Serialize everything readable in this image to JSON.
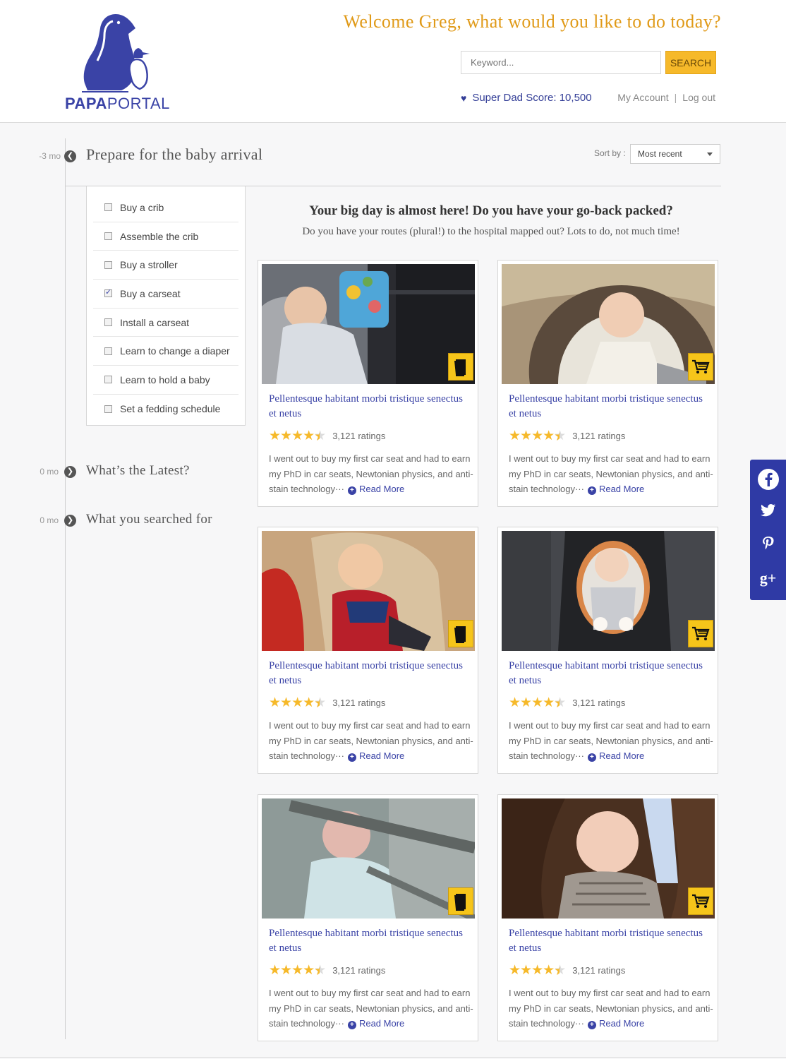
{
  "brand": {
    "name_bold": "PAPA",
    "name_light": "PORTAL"
  },
  "header": {
    "welcome": "Welcome Greg, what would you like to do today?",
    "search_placeholder": "Keyword...",
    "search_button": "SEARCH",
    "score_label": "Super Dad Score: 10,500",
    "my_account": "My Account",
    "separator": "|",
    "logout": "Log out"
  },
  "timeline": [
    {
      "mo": "-3 mo",
      "title": "Prepare for the baby arrival",
      "icon": "arrow-left-circle-icon"
    },
    {
      "mo": "0 mo",
      "title": "What’s the Latest?",
      "icon": "arrow-right-circle-icon"
    },
    {
      "mo": "0 mo",
      "title": "What you searched for",
      "icon": "arrow-right-circle-icon"
    }
  ],
  "sort": {
    "label": "Sort by :",
    "value": "Most recent"
  },
  "checklist": [
    {
      "label": "Buy a crib",
      "checked": false
    },
    {
      "label": "Assemble the crib",
      "checked": false
    },
    {
      "label": "Buy a stroller",
      "checked": false
    },
    {
      "label": "Buy a carseat",
      "checked": true
    },
    {
      "label": "Install a carseat",
      "checked": false
    },
    {
      "label": "Learn to change a diaper",
      "checked": false
    },
    {
      "label": "Learn to hold a baby",
      "checked": false
    },
    {
      "label": "Set a fedding schedule",
      "checked": false
    }
  ],
  "main": {
    "headline": "Your big day is almost here! Do you have your go-back packed?",
    "subhead": "Do you have your routes (plural!) to the hospital mapped out? Lots to do, not much time!"
  },
  "cards": [
    {
      "badge": "document-icon",
      "title": "Pellentesque habitant morbi tristique senectus et netus",
      "rating": 4.5,
      "ratings_text": "3,121 ratings",
      "desc": "I went out to buy my first car seat and had to earn my PhD in car seats, Newtonian physics, and anti-stain technology···",
      "read_more": "Read More"
    },
    {
      "badge": "cart-icon",
      "title": "Pellentesque habitant morbi tristique senectus et netus",
      "rating": 4.5,
      "ratings_text": "3,121 ratings",
      "desc": "I went out to buy my first car seat and had to earn my PhD in car seats, Newtonian physics, and anti-stain technology···",
      "read_more": "Read More"
    },
    {
      "badge": "document-icon",
      "title": "Pellentesque habitant morbi tristique senectus et netus",
      "rating": 4.5,
      "ratings_text": "3,121 ratings",
      "desc": "I went out to buy my first car seat and had to earn my PhD in car seats, Newtonian physics, and anti-stain technology···",
      "read_more": "Read More"
    },
    {
      "badge": "cart-icon",
      "title": "Pellentesque habitant morbi tristique senectus et netus",
      "rating": 4.5,
      "ratings_text": "3,121 ratings",
      "desc": "I went out to buy my first car seat and had to earn my PhD in car seats, Newtonian physics, and anti-stain technology···",
      "read_more": "Read More"
    },
    {
      "badge": "document-icon",
      "title": "Pellentesque habitant morbi tristique senectus et netus",
      "rating": 4.5,
      "ratings_text": "3,121 ratings",
      "desc": "I went out to buy my first car seat and had to earn my PhD in car seats, Newtonian physics, and anti-stain technology···",
      "read_more": "Read More"
    },
    {
      "badge": "cart-icon",
      "title": "Pellentesque habitant morbi tristique senectus et netus",
      "rating": 4.5,
      "ratings_text": "3,121 ratings",
      "desc": "I went out to buy my first car seat and had to earn my PhD in car seats, Newtonian physics, and anti-stain technology···",
      "read_more": "Read More"
    }
  ],
  "social": [
    {
      "icon": "facebook-icon",
      "glyph": "f"
    },
    {
      "icon": "twitter-icon",
      "glyph": "🐦"
    },
    {
      "icon": "pinterest-icon",
      "glyph": "P"
    },
    {
      "icon": "google-plus-icon",
      "glyph": "g+"
    }
  ],
  "colors": {
    "brand_blue": "#3a43a6",
    "accent_orange": "#e09a18",
    "search_yellow": "#f6b92a",
    "badge_yellow": "#f6c51a"
  }
}
